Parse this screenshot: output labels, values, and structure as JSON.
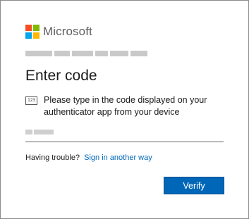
{
  "brand": {
    "name": "Microsoft",
    "logo_colors": [
      "#f25022",
      "#7fba00",
      "#00a4ef",
      "#ffb900"
    ]
  },
  "title": "Enter code",
  "instruction": {
    "icon": "numeric-code-icon",
    "icon_glyph": "123",
    "text": "Please type in the code displayed on your authenticator app from your device"
  },
  "code_input": {
    "value": "",
    "placeholder": ""
  },
  "trouble": {
    "prefix": "Having trouble?",
    "link_label": "Sign in another way"
  },
  "actions": {
    "verify_label": "Verify"
  },
  "colors": {
    "accent": "#0067b8",
    "text": "#1b1b1b"
  }
}
